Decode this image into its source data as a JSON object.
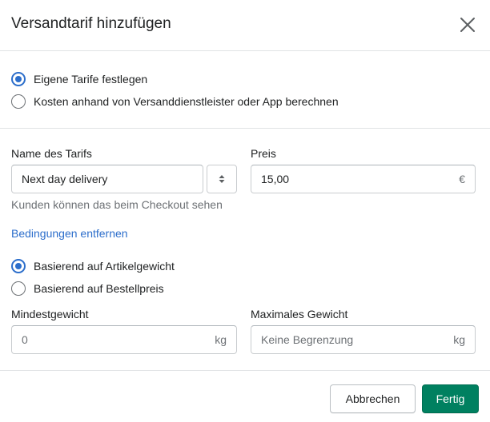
{
  "dialog": {
    "title": "Versandtarif hinzufügen",
    "close_icon": "close-icon"
  },
  "rate_type": {
    "options": [
      {
        "label": "Eigene Tarife festlegen",
        "selected": true
      },
      {
        "label": "Kosten anhand von Versanddienstleister oder App berechnen",
        "selected": false
      }
    ]
  },
  "rate_name": {
    "label": "Name des Tarifs",
    "value": "Next day delivery",
    "help": "Kunden können das beim Checkout sehen",
    "stepper_icon": "sort-arrows-icon"
  },
  "price": {
    "label": "Preis",
    "value": "15,00",
    "suffix": "€"
  },
  "conditions": {
    "remove_link": "Bedingungen entfernen",
    "options": [
      {
        "label": "Basierend auf Artikelgewicht",
        "selected": true
      },
      {
        "label": "Basierend auf Bestellpreis",
        "selected": false
      }
    ]
  },
  "min_weight": {
    "label": "Mindestgewicht",
    "placeholder": "0",
    "suffix": "kg"
  },
  "max_weight": {
    "label": "Maximales Gewicht",
    "placeholder": "Keine Begrenzung",
    "suffix": "kg"
  },
  "footer": {
    "cancel_label": "Abbrechen",
    "done_label": "Fertig"
  },
  "colors": {
    "accent": "#2c6ecb",
    "primary_button": "#008060",
    "border": "#c9cccf"
  }
}
